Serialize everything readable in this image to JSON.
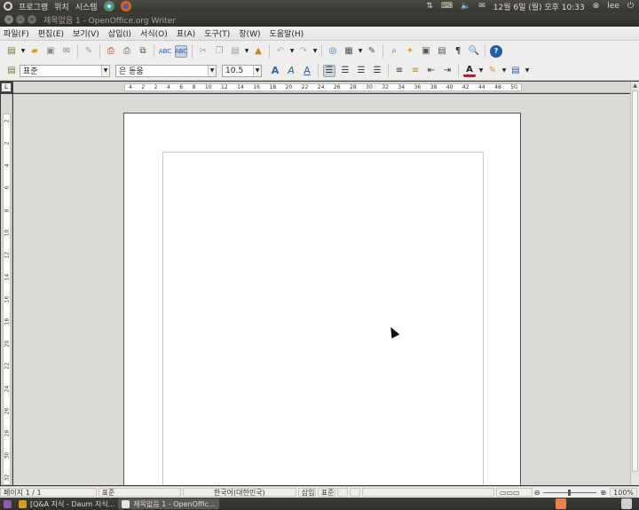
{
  "top_panel": {
    "menus": [
      "프로그램",
      "위치",
      "시스템"
    ],
    "clock": "12월 6일 (월) 오후 10:33",
    "user": "lee"
  },
  "window": {
    "title": "제목없음 1 - OpenOffice.org Writer"
  },
  "menubar": [
    "파일(F)",
    "편집(E)",
    "보기(V)",
    "삽입(I)",
    "서식(O)",
    "표(A)",
    "도구(T)",
    "창(W)",
    "도움말(H)"
  ],
  "formatting": {
    "style": "표준",
    "font": "은 돋움",
    "size": "10.5"
  },
  "ruler": {
    "h_ticks": [
      "4",
      "2",
      "2",
      "4",
      "6",
      "8",
      "10",
      "12",
      "14",
      "16",
      "18",
      "20",
      "22",
      "24",
      "26",
      "28",
      "30",
      "32",
      "34",
      "36",
      "38",
      "40",
      "42",
      "44",
      "48",
      "50"
    ],
    "v_ticks": [
      "2",
      "2",
      "4",
      "6",
      "8",
      "10",
      "12",
      "14",
      "16",
      "18",
      "20",
      "22",
      "24",
      "26",
      "28",
      "30",
      "32"
    ]
  },
  "statusbar": {
    "page": "페이지 1 / 1",
    "style": "표준",
    "language": "한국어(대한민국)",
    "insert_mode": "삽입",
    "selection_mode": "표준",
    "zoom": "100%"
  },
  "taskbar": {
    "tasks": [
      "[Q&A 지식 - Daum 지식...",
      "제목없음 1 - OpenOffic..."
    ]
  },
  "colors": {
    "panel": "#3c3b37",
    "page_bg": "#dcdad5",
    "toolbar": "#efeeec"
  }
}
